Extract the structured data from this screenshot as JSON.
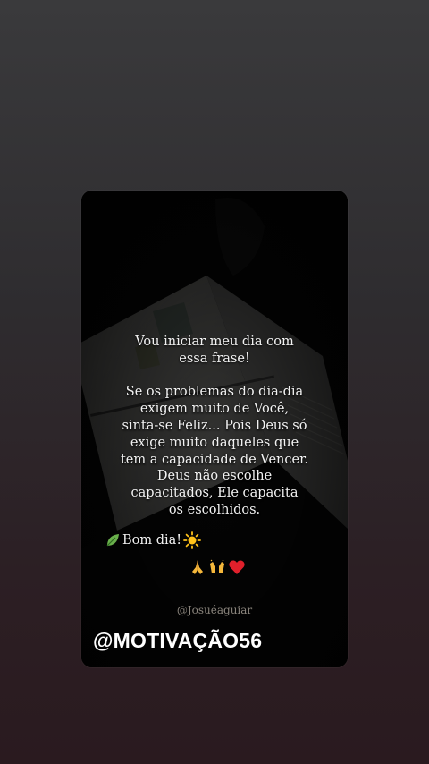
{
  "story": {
    "quote_lines": [
      "Vou iniciar meu dia com",
      "essa frase!",
      "",
      "Se os problemas do dia-dia",
      "exigem muito de Você,",
      "sinta-se Feliz... Pois Deus só",
      "exige muito daqueles que",
      "tem a capacidade de Vencer.",
      "Deus não escolhe",
      "capacitados, Ele capacita",
      "os escolhidos."
    ],
    "greeting": "Bom dia!",
    "greeting_icons": [
      "leaf-icon",
      "sun-icon"
    ],
    "reaction_icons": [
      "praying-hands-icon",
      "raising-hands-icon",
      "heart-icon"
    ],
    "handle": "@Josuéaguiar",
    "brand": "@MOTIVAÇÃO56"
  },
  "colors": {
    "card_background": "#070707",
    "text": "#f2f2f2",
    "handle": "#8a847c",
    "heart": "#e0202b",
    "sun": "#ffc21a",
    "leaf": "#6ab04c"
  }
}
